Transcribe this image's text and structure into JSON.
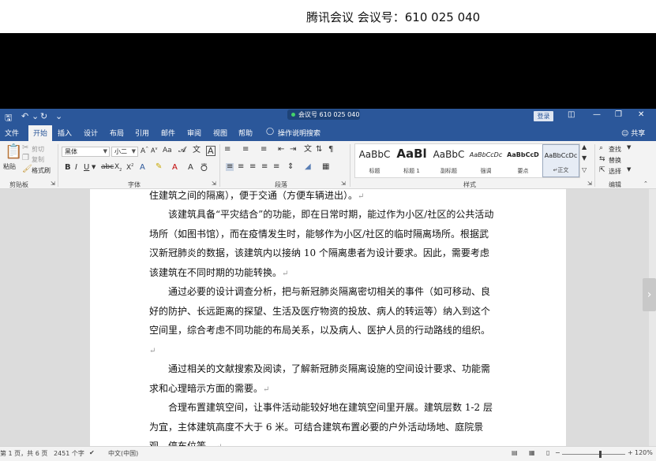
{
  "meeting": {
    "banner_title": "腾讯会议 会议号：610 025 040",
    "titlebar_pill": "会议号 610 025 040"
  },
  "titlebar": {
    "login_label": "登录"
  },
  "tabs": [
    {
      "label": "文件",
      "active": false
    },
    {
      "label": "开始",
      "active": true
    },
    {
      "label": "插入",
      "active": false
    },
    {
      "label": "设计",
      "active": false
    },
    {
      "label": "布局",
      "active": false
    },
    {
      "label": "引用",
      "active": false
    },
    {
      "label": "邮件",
      "active": false
    },
    {
      "label": "审阅",
      "active": false
    },
    {
      "label": "视图",
      "active": false
    },
    {
      "label": "帮助",
      "active": false
    }
  ],
  "tell_me": "操作说明搜索",
  "share_label": "共享",
  "ribbon": {
    "clipboard": {
      "paste": "粘贴",
      "cut": "剪切",
      "copy": "复制",
      "format_painter": "格式刷",
      "label": "剪贴板"
    },
    "font": {
      "font_name": "黑体",
      "font_size": "小二",
      "label": "字体"
    },
    "paragraph": {
      "label": "段落"
    },
    "styles": {
      "label": "样式",
      "items": [
        {
          "sample": "AaBbC",
          "name": "标题"
        },
        {
          "sample": "AaBl",
          "name": "标题 1"
        },
        {
          "sample": "AaBbC",
          "name": "副标题"
        },
        {
          "sample": "AaBbCcDc",
          "name": "强调"
        },
        {
          "sample": "AaBbCcD",
          "name": "要点"
        },
        {
          "sample": "AaBbCcDc",
          "name": "↵正文"
        }
      ]
    },
    "editing": {
      "find": "查找",
      "replace": "替换",
      "select": "选择",
      "label": "编辑"
    }
  },
  "document": {
    "paragraphs": [
      {
        "text": "住建筑之间的隔离），便于交通（方便车辆进出）。",
        "indent": false
      },
      {
        "text": "该建筑具备“平灾结合”的功能，即在日常时期，能过作为小区/社区的公共活动场所（如图书馆），而在疫情发生时，能够作为小区/社区的临时隔离场所。根据武汉新冠肺炎的数据，该建筑内以接纳 10 个隔离患者为设计要求。因此，需要考虑该建筑在不同时期的功能转换。",
        "indent": true
      },
      {
        "text": "通过必要的设计调查分析，把与新冠肺炎隔离密切相关的事件（如可移动、良好的防护、长远距离的探望、生活及医疗物资的投放、病人的转运等）纳入到这个空间里，综合考虑不同功能的布局关系，以及病人、医护人员的行动路线的组织。",
        "indent": true
      },
      {
        "text": "通过相关的文献搜索及阅读，了解新冠肺炎隔离设施的空间设计要求、功能需求和心理暗示方面的需要。",
        "indent": true
      },
      {
        "text": "合理布置建筑空间，让事件活动能较好地在建筑空间里开展。建筑层数 1-2 层为宜，主体建筑高度不大于 6 米。可结合建筑布置必要的户外活动场地、庭院景观，停车位等。",
        "indent": true
      }
    ]
  },
  "statusbar": {
    "page": "第 1 页，共 6 页",
    "words": "2451 个字",
    "language": "中文(中国)",
    "zoom": "120%",
    "zoom_fraction": 0.6
  }
}
